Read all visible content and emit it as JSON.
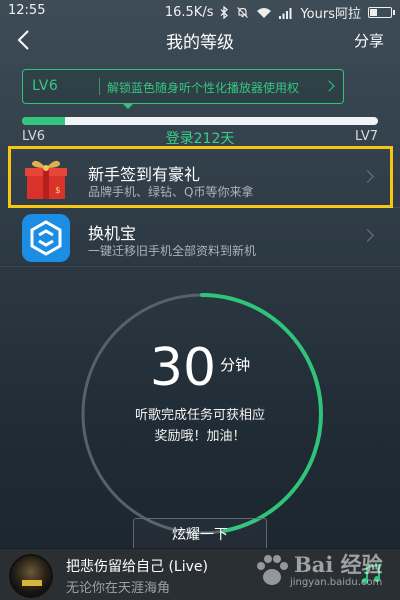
{
  "status_bar": {
    "time": "12:55",
    "net_speed": "16.5K/s",
    "carrier": "Yours阿拉",
    "battery_level": 0.35
  },
  "header": {
    "title": "我的等级",
    "share_label": "分享"
  },
  "level_tip": {
    "badge": "LV6",
    "text": "解锁蓝色随身听个性化播放器使用权"
  },
  "progress": {
    "current_level": "LV6",
    "next_level": "LV7",
    "login_days": "登录212天",
    "fraction": 0.12,
    "accent_color": "#33c47d"
  },
  "list": [
    {
      "icon": "gift-icon",
      "title": "新手签到有豪礼",
      "subtitle": "品牌手机、绿钻、Q币等你来拿",
      "highlighted": true
    },
    {
      "icon": "huanjibao-app-icon",
      "title": "换机宝",
      "subtitle": "一键迁移旧手机全部资料到新机",
      "highlighted": false
    }
  ],
  "timer": {
    "value": "30",
    "unit": "分钟",
    "desc_line1": "听歌完成任务可获相应",
    "desc_line2": "奖励哦！加油！",
    "ring_progress": 0.47,
    "ring_color": "#2fc47a"
  },
  "show_off_button": "炫耀一下",
  "player": {
    "song": "把悲伤留给自己 (Live)",
    "subtitle": "无论你在天涯海角"
  },
  "watermark": {
    "brand": "Bai 经验",
    "url": "jingyan.baidu.com"
  }
}
